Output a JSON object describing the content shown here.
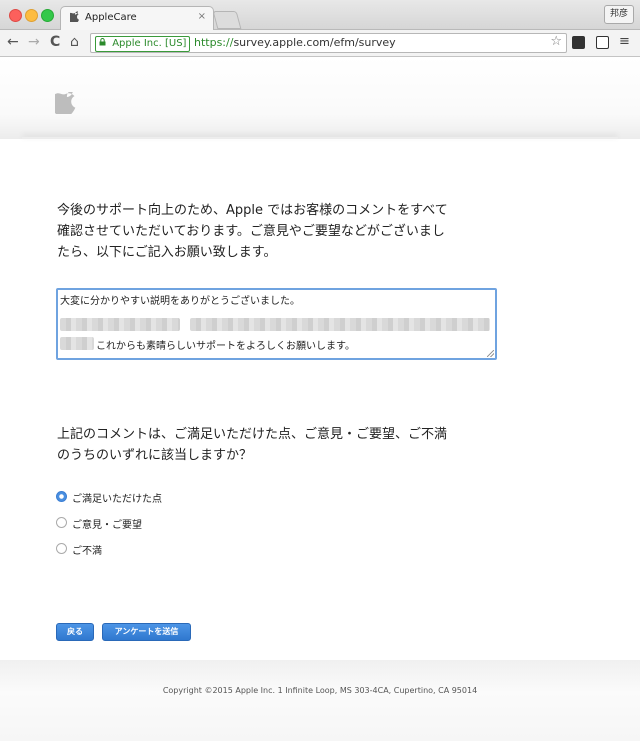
{
  "browser": {
    "tab_title": "AppleCare",
    "tab_close": "×",
    "profile_label": "邦彦",
    "ev_label": "Apple Inc. [US]",
    "url_scheme": "https://",
    "url_rest": "survey.apple.com/efm/survey",
    "nav": {
      "back": "←",
      "forward": "→",
      "reload": "C",
      "home": "⌂"
    },
    "star": "☆",
    "menu": "≡"
  },
  "survey": {
    "intro": "今後のサポート向上のため、Apple ではお客様のコメントをすべて確認させていただいております。ご意見やご要望などがございましたら、以下にご記入お願い致します。",
    "comment": {
      "line1": "大変に分かりやすい説明をありがとうございました。",
      "line3": "これからも素晴らしいサポートをよろしくお願いします。"
    },
    "question": "上記のコメントは、ご満足いただけた点、ご意見・ご要望、ご不満のうちのいずれに該当しますか？",
    "options": [
      {
        "label": "ご満足いただけた点",
        "selected": true
      },
      {
        "label": "ご意見・ご要望",
        "selected": false
      },
      {
        "label": "ご不満",
        "selected": false
      }
    ],
    "buttons": {
      "back": "戻る",
      "submit": "アンケートを送信"
    }
  },
  "footer": {
    "copyright": "Copyright ©2015 Apple Inc. 1 Infinite Loop, MS 303-4CA, Cupertino, CA 95014"
  },
  "colors": {
    "accent": "#3b7fd4",
    "button": "#2f78cf",
    "secure_green": "#2b8a2b"
  }
}
